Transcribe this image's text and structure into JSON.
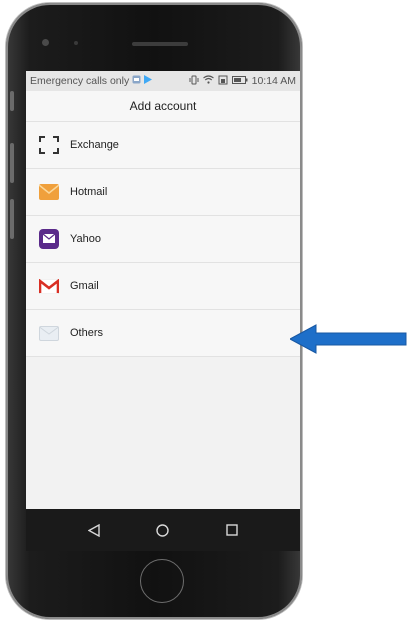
{
  "status_bar": {
    "carrier_text": "Emergency calls only",
    "time": "10:14 AM"
  },
  "header": {
    "title": "Add account"
  },
  "accounts": [
    {
      "label": "Exchange",
      "icon": "exchange-icon"
    },
    {
      "label": "Hotmail",
      "icon": "hotmail-icon"
    },
    {
      "label": "Yahoo",
      "icon": "yahoo-icon"
    },
    {
      "label": "Gmail",
      "icon": "gmail-icon"
    },
    {
      "label": "Others",
      "icon": "others-mail-icon"
    }
  ],
  "navigation": {
    "back": "back-icon",
    "home": "home-icon",
    "recents": "recents-icon"
  },
  "colors": {
    "arrow": "#1e6fc9",
    "hotmail": "#f0a03c",
    "yahoo": "#5a2a8a",
    "gmail": "#d93025"
  }
}
